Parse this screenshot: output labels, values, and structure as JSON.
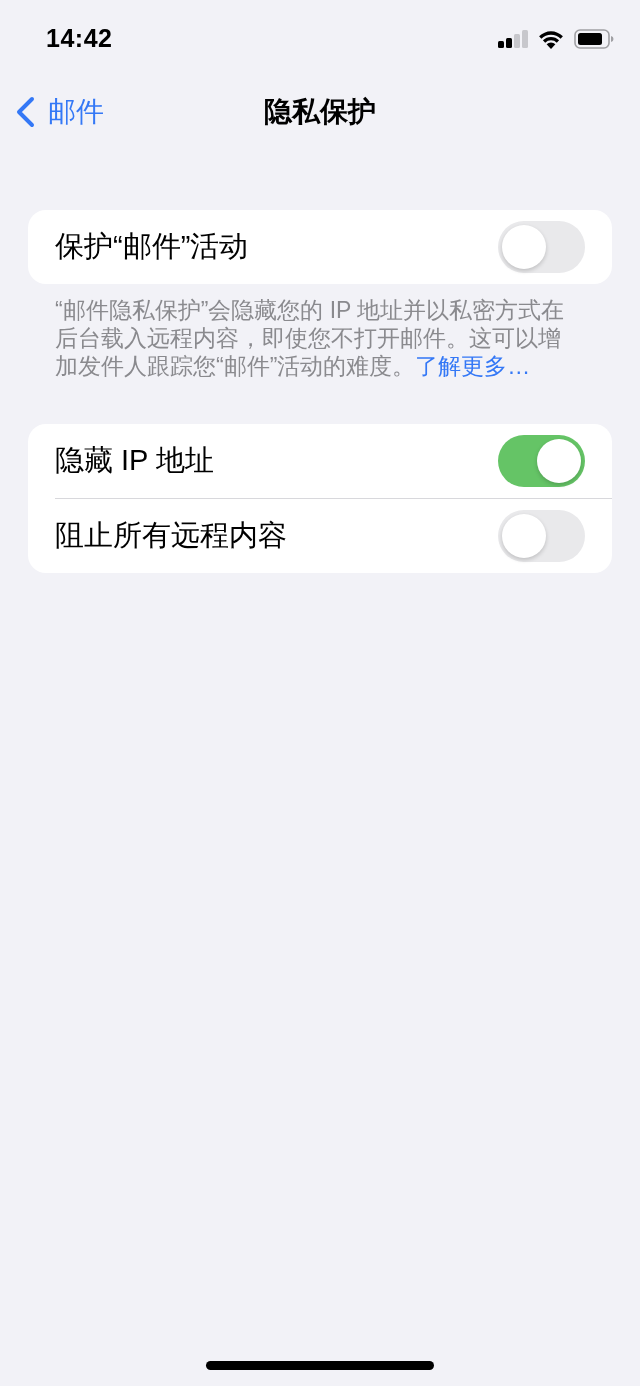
{
  "status_bar": {
    "time": "14:42"
  },
  "nav_bar": {
    "back_label": "邮件",
    "title": "隐私保护"
  },
  "sections": [
    {
      "rows": [
        {
          "label": "保护“邮件”活动",
          "on": false
        }
      ],
      "footer": {
        "text": "“邮件隐私保护”会隐藏您的 IP 地址并以私密方式在后台载入远程内容，即使您不打开邮件。这可以增加发件人跟踪您“邮件”活动的难度。",
        "link": "了解更多…"
      }
    },
    {
      "rows": [
        {
          "label": "隐藏 IP 地址",
          "on": true
        },
        {
          "label": "阻止所有远程内容",
          "on": false
        }
      ]
    }
  ]
}
